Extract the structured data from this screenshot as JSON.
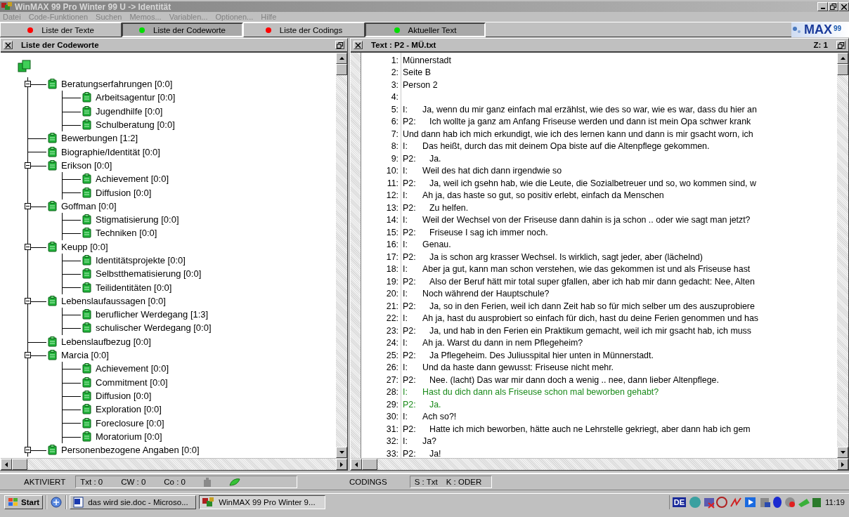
{
  "window": {
    "title": "WinMAX 99 Pro Winter 99 U -> Identität"
  },
  "menu": [
    {
      "label": "Datei"
    },
    {
      "label": "Code-Funktionen"
    },
    {
      "label": "Suchen"
    },
    {
      "label": "Memos..."
    },
    {
      "label": "Variablen..."
    },
    {
      "label": "Optionen..."
    },
    {
      "label": "Hilfe"
    }
  ],
  "tabs": [
    {
      "label": "Liste der Texte",
      "selected": false,
      "color": "#ff0000"
    },
    {
      "label": "Liste der Codeworte",
      "selected": true,
      "color": "#00dd00"
    },
    {
      "label": "Liste der Codings",
      "selected": false,
      "color": "#ff0000"
    },
    {
      "label": "Aktueller Text",
      "selected": true,
      "color": "#00dd00"
    }
  ],
  "logo": {
    "name": "MAX",
    "version": "99"
  },
  "code_panel": {
    "title": "Liste der Codeworte",
    "tree": [
      {
        "label": "Beratungserfahrungen [0:0]",
        "expanded": true,
        "children": [
          {
            "label": "Arbeitsagentur [0:0]"
          },
          {
            "label": "Jugendhilfe [0:0]"
          },
          {
            "label": "Schulberatung [0:0]"
          }
        ]
      },
      {
        "label": "Bewerbungen [1:2]"
      },
      {
        "label": "Biographie/Identität [0:0]"
      },
      {
        "label": "Erikson [0:0]",
        "expanded": true,
        "children": [
          {
            "label": "Achievement [0:0]"
          },
          {
            "label": "Diffusion [0:0]"
          }
        ]
      },
      {
        "label": "Goffman [0:0]",
        "expanded": true,
        "children": [
          {
            "label": "Stigmatisierung [0:0]"
          },
          {
            "label": "Techniken [0:0]"
          }
        ]
      },
      {
        "label": "Keupp [0:0]",
        "expanded": true,
        "children": [
          {
            "label": "Identitätsprojekte [0:0]"
          },
          {
            "label": "Selbstthematisierung [0:0]"
          },
          {
            "label": "Teilidentitäten [0:0]"
          }
        ]
      },
      {
        "label": "Lebenslaufaussagen [0:0]",
        "expanded": true,
        "children": [
          {
            "label": "beruflicher Werdegang [1:3]"
          },
          {
            "label": "schulischer Werdegang [0:0]"
          }
        ]
      },
      {
        "label": "Lebenslaufbezug [0:0]"
      },
      {
        "label": "Marcia [0:0]",
        "expanded": true,
        "children": [
          {
            "label": "Achievement [0:0]"
          },
          {
            "label": "Commitment [0:0]"
          },
          {
            "label": "Diffusion [0:0]"
          },
          {
            "label": "Exploration [0:0]"
          },
          {
            "label": "Foreclosure [0:0]"
          },
          {
            "label": "Moratorium [0:0]"
          }
        ]
      },
      {
        "label": "Personenbezogene Angaben [0:0]",
        "expanded": true
      }
    ]
  },
  "text_panel": {
    "title": "Text :  P2 - MÜ.txt",
    "position": "Z: 1",
    "lines": [
      {
        "number": "1:",
        "text": "Münnerstadt",
        "highlighted": false
      },
      {
        "number": "2:",
        "text": "Seite B",
        "highlighted": false
      },
      {
        "number": "3:",
        "text": "Person 2",
        "highlighted": false
      },
      {
        "number": "4:"
      },
      {
        "number": "5:",
        "speaker": "I:",
        "text": "Ja, wenn du mir ganz einfach mal erzählst, wie des so war, wie es war, dass du hier an",
        "highlighted": false
      },
      {
        "number": "6:",
        "speaker": "P2:",
        "text": "Ich wollte ja ganz am Anfang Friseuse werden und dann ist mein Opa schwer krank",
        "highlighted": false
      },
      {
        "number": "7:",
        "text": "Und dann hab ich mich erkundigt, wie ich des lernen kann und dann is mir gsacht worn, ich",
        "highlighted": false
      },
      {
        "number": "8:",
        "speaker": "I:",
        "text": "Das heißt, durch das mit deinem Opa biste auf die Altenpflege gekommen.",
        "highlighted": false
      },
      {
        "number": "9:",
        "speaker": "P2:",
        "text": "Ja.",
        "highlighted": false
      },
      {
        "number": "10:",
        "speaker": "I:",
        "text": "Weil des hat dich dann irgendwie so",
        "highlighted": false
      },
      {
        "number": "11:",
        "speaker": "P2:",
        "text": "Ja, weil ich gsehn hab, wie die Leute, die Sozialbetreuer und so, wo kommen sind, w",
        "highlighted": false
      },
      {
        "number": "12:",
        "speaker": "I:",
        "text": "Ah ja, das haste so gut, so positiv erlebt, einfach da Menschen",
        "highlighted": false
      },
      {
        "number": "13:",
        "speaker": "P2:",
        "text": "Zu helfen.",
        "highlighted": false
      },
      {
        "number": "14:",
        "speaker": "I:",
        "text": "Weil der Wechsel von der Friseuse dann dahin is ja schon .. oder wie sagt man jetzt?",
        "highlighted": false
      },
      {
        "number": "15:",
        "speaker": "P2:",
        "text": "Friseuse I sag ich immer noch.",
        "highlighted": false
      },
      {
        "number": "16:",
        "speaker": "I:",
        "text": "Genau.",
        "highlighted": false
      },
      {
        "number": "17:",
        "speaker": "P2:",
        "text": "Ja is schon arg krasser Wechsel. Is wirklich, sagt jeder, aber (lächelnd)",
        "highlighted": false
      },
      {
        "number": "18:",
        "speaker": "I:",
        "text": "Aber ja gut, kann man schon verstehen, wie das gekommen ist und als Friseuse hast",
        "highlighted": false
      },
      {
        "number": "19:",
        "speaker": "P2:",
        "text": "Also der Beruf hätt mir total super gfallen, aber ich hab mir dann gedacht: Nee, Alten",
        "highlighted": false
      },
      {
        "number": "20:",
        "speaker": "I:",
        "text": "Noch während der Hauptschule?",
        "highlighted": false
      },
      {
        "number": "21:",
        "speaker": "P2:",
        "text": "Ja, so in den Ferien, weil ich dann Zeit hab so für mich selber um des auszuprobiere",
        "highlighted": false
      },
      {
        "number": "22:",
        "speaker": "I:",
        "text": "Ah ja, hast du ausprobiert so einfach für dich, hast du deine Ferien genommen und has",
        "highlighted": false
      },
      {
        "number": "23:",
        "speaker": "P2:",
        "text": "Ja, und hab in den Ferien ein Praktikum gemacht, weil ich mir gsacht hab, ich muss",
        "highlighted": false
      },
      {
        "number": "24:",
        "speaker": "I:",
        "text": "Ah ja. Warst du dann in nem Pflegeheim?",
        "highlighted": false
      },
      {
        "number": "25:",
        "speaker": "P2:",
        "text": "Ja Pflegeheim. Des Juliusspital hier unten in Münnerstadt.",
        "highlighted": false
      },
      {
        "number": "26:",
        "speaker": "I:",
        "text": "Und da haste dann gewusst: Friseuse nicht mehr.",
        "highlighted": false
      },
      {
        "number": "27:",
        "speaker": "P2:",
        "text": "Nee. (lacht) Das war mir dann doch a wenig .. nee, dann lieber Altenpflege.",
        "highlighted": false
      },
      {
        "number": "28:",
        "speaker": "I:",
        "text": "Hast du dich dann als Friseuse schon mal beworben gehabt?",
        "highlighted": true
      },
      {
        "number": "29:",
        "speaker": "P2:",
        "text": "Ja.",
        "highlighted": true
      },
      {
        "number": "30:",
        "speaker": "I:",
        "text": "Ach so?!",
        "highlighted": false
      },
      {
        "number": "31:",
        "speaker": "P2:",
        "text": "Hatte ich mich beworben, hätte auch ne Lehrstelle gekriegt, aber dann hab ich gem",
        "highlighted": false
      },
      {
        "number": "32:",
        "speaker": "I:",
        "text": "Ja?",
        "highlighted": false
      },
      {
        "number": "33:",
        "speaker": "P2:",
        "text": "Ja!",
        "highlighted": false
      }
    ]
  },
  "status_bar": {
    "mode": "AKTIVIERT",
    "txt": "Txt : 0",
    "cw": "CW : 0",
    "co": "Co : 0",
    "codings": "CODINGS",
    "s": "S : Txt",
    "k": "K : ODER"
  },
  "taskbar": {
    "start": "Start",
    "tasks": [
      {
        "label": "das wird sie.doc - Microso...",
        "kind": "document",
        "selected": false
      },
      {
        "label": "WinMAX 99 Pro Winter 9...",
        "kind": "app",
        "selected": true
      }
    ],
    "language": "DE",
    "clock": "11:19"
  }
}
